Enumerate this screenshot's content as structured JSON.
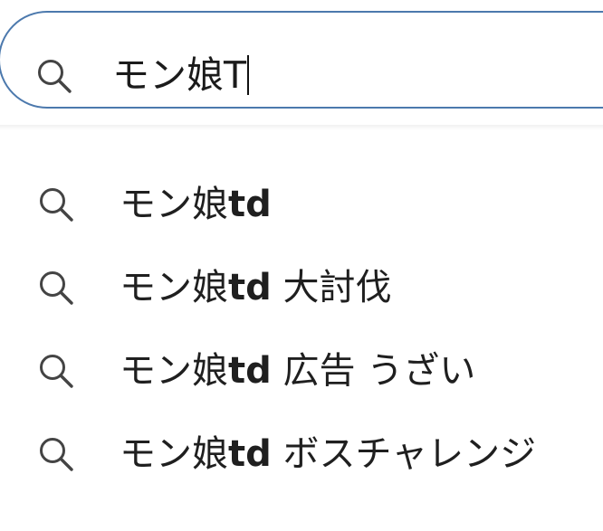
{
  "search": {
    "value": "モン娘T",
    "icon": "search-icon"
  },
  "suggestions": [
    {
      "prefix": "モン娘",
      "completion": "td",
      "suffix": "",
      "icon": "search-icon"
    },
    {
      "prefix": "モン娘",
      "completion": "td",
      "suffix": " 大討伐",
      "icon": "search-icon"
    },
    {
      "prefix": "モン娘",
      "completion": "td",
      "suffix": " 広告 うざい",
      "icon": "search-icon"
    },
    {
      "prefix": "モン娘",
      "completion": "td",
      "suffix": " ボスチャレンジ",
      "icon": "search-icon"
    }
  ],
  "colors": {
    "box_border": "#4c79ad",
    "icon": "#444444",
    "text": "#1f1f1f"
  }
}
